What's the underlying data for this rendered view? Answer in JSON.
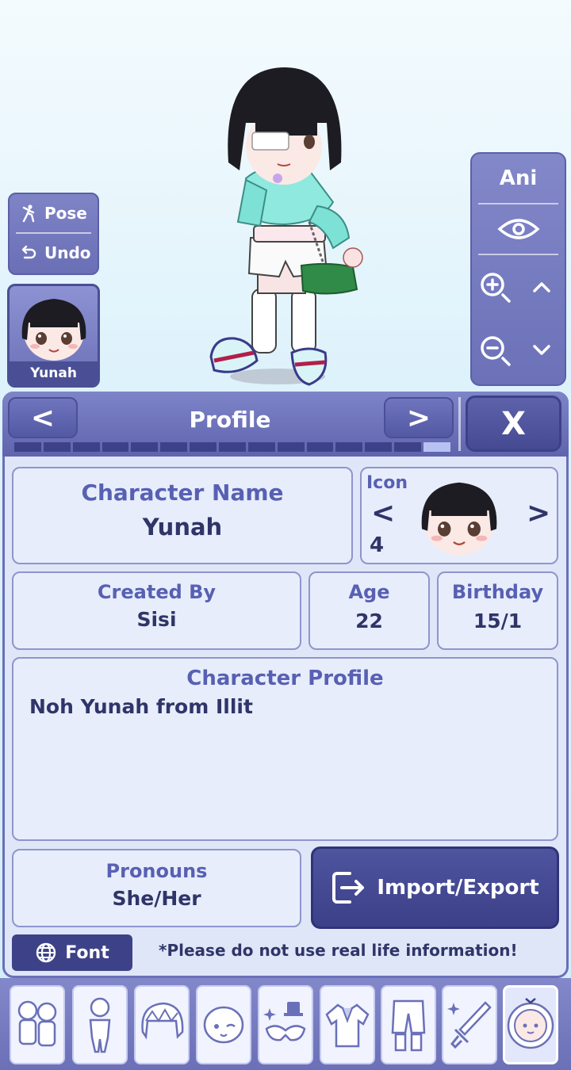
{
  "tools": {
    "pose_label": "Pose",
    "undo_label": "Undo"
  },
  "character_card": {
    "name": "Yunah"
  },
  "camera": {
    "ani_label": "Ani"
  },
  "header": {
    "title": "Profile",
    "prev": "<",
    "next": ">",
    "close": "X"
  },
  "progress": {
    "segments": 15,
    "active_index": 14
  },
  "fields": {
    "name_title": "Character Name",
    "name_value": "Yunah",
    "icon_title": "Icon",
    "icon_prev": "<",
    "icon_next": ">",
    "icon_number": "4",
    "created_title": "Created By",
    "created_value": "Sisi",
    "age_title": "Age",
    "age_value": "22",
    "birthday_title": "Birthday",
    "birthday_value": "15/1",
    "profile_title": "Character Profile",
    "profile_value": "Noh Yunah from Illit",
    "pronouns_title": "Pronouns",
    "pronouns_value": "She/Her"
  },
  "actions": {
    "import_export": "Import/Export",
    "font": "Font"
  },
  "notice": "*Please do not use real life information!",
  "tabs": [
    "presets-tab",
    "body-tab",
    "hair-tab",
    "face-tab",
    "accessories-tab",
    "top-tab",
    "bottom-tab",
    "props-tab",
    "profile-tab"
  ],
  "colors": {
    "accent": "#6a70b8",
    "dark": "#3d4288",
    "title_text": "#5860b3",
    "value_text": "#2f3568"
  }
}
